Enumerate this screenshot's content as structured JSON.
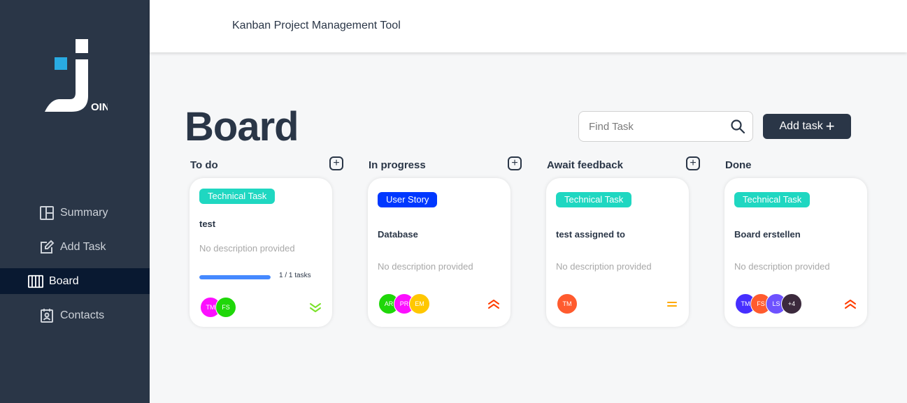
{
  "app": {
    "title": "Kanban Project Management Tool",
    "logo_text": "OIN",
    "colors": {
      "sidebar": "#2a3647",
      "active_nav": "#091931",
      "accent": "#29abe2"
    }
  },
  "sidebar": {
    "items": [
      {
        "label": "Summary",
        "icon": "summary-icon",
        "active": false
      },
      {
        "label": "Add Task",
        "icon": "edit-icon",
        "active": false
      },
      {
        "label": "Board",
        "icon": "board-icon",
        "active": true
      },
      {
        "label": "Contacts",
        "icon": "contacts-icon",
        "active": false
      }
    ]
  },
  "board": {
    "title": "Board",
    "search": {
      "placeholder": "Find Task",
      "value": ""
    },
    "add_task_label": "Add task",
    "columns": [
      {
        "title": "To do",
        "card": {
          "category": "Technical Task",
          "category_color": "#1fd7c1",
          "title": "test",
          "description": "No description provided",
          "subtasks": {
            "done": 1,
            "total": 1,
            "label": "1 / 1 tasks"
          },
          "assignees": [
            {
              "initials": "TM",
              "color": "#fc0fff"
            },
            {
              "initials": "FS",
              "color": "#1fd709"
            }
          ],
          "priority": "low",
          "priority_color": "#7ae229"
        }
      },
      {
        "title": "In progress",
        "card": {
          "category": "User Story",
          "category_color": "#0038ff",
          "title": "Database",
          "description": "No description provided",
          "assignees": [
            {
              "initials": "AR",
              "color": "#1fd709"
            },
            {
              "initials": "PR",
              "color": "#fc0fff"
            },
            {
              "initials": "EM",
              "color": "#ffc701"
            }
          ],
          "priority": "urgent",
          "priority_color": "#ff3d00"
        }
      },
      {
        "title": "Await feedback",
        "card": {
          "category": "Technical Task",
          "category_color": "#1fd7c1",
          "title": "test assigned to",
          "description": "No description provided",
          "assignees": [
            {
              "initials": "TM",
              "color": "#ff5b2e"
            }
          ],
          "priority": "medium",
          "priority_color": "#ffa800"
        }
      },
      {
        "title": "Done",
        "card": {
          "category": "Technical Task",
          "category_color": "#1fd7c1",
          "title": "Board erstellen",
          "description": "No description provided",
          "assignees": [
            {
              "initials": "TM",
              "color": "#462fff"
            },
            {
              "initials": "FS",
              "color": "#ff5b2e"
            },
            {
              "initials": "LS",
              "color": "#6e52ff"
            },
            {
              "initials": "+4",
              "color": "#3c2a3d"
            }
          ],
          "priority": "urgent",
          "priority_color": "#ff3d00"
        }
      }
    ]
  }
}
